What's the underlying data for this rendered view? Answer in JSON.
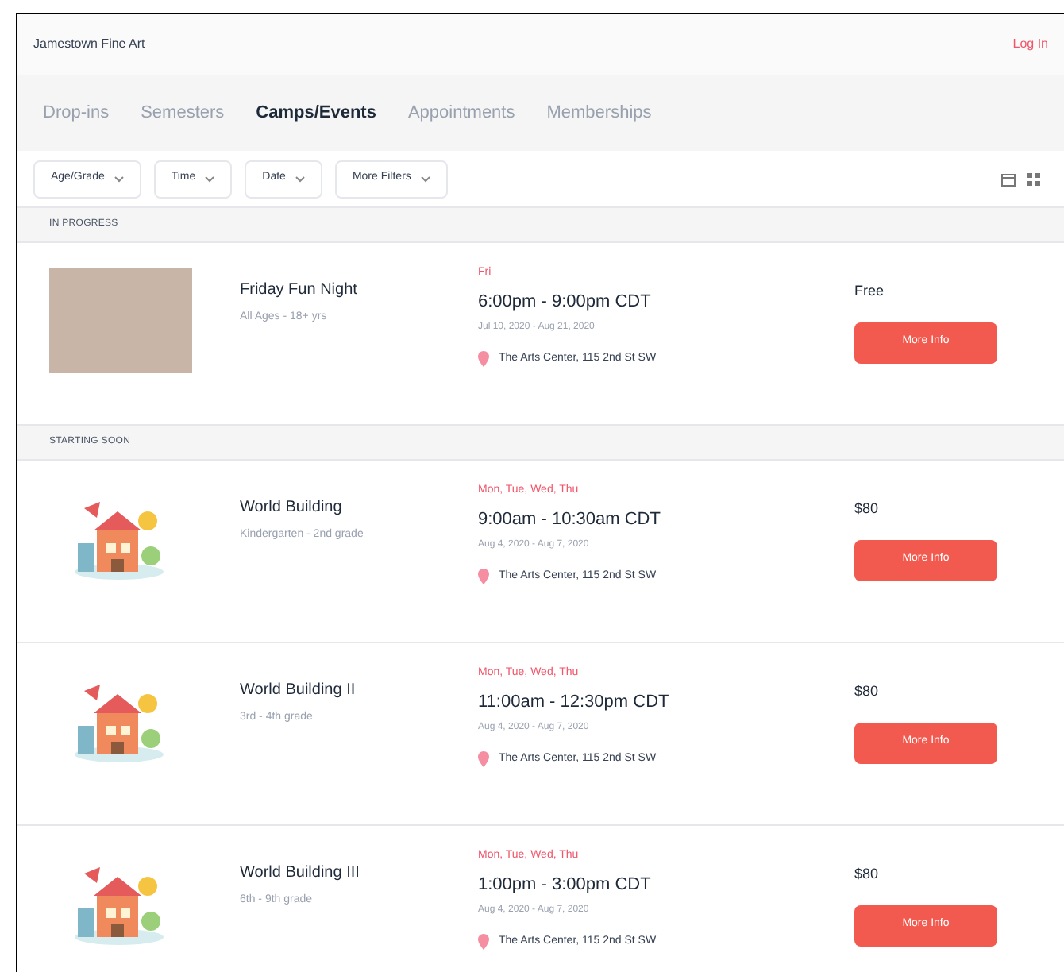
{
  "header": {
    "title": "Jamestown Fine Art",
    "login": "Log In"
  },
  "tabs": [
    {
      "label": "Drop-ins",
      "selected": false
    },
    {
      "label": "Semesters",
      "selected": false
    },
    {
      "label": "Camps/Events",
      "selected": true
    },
    {
      "label": "Appointments",
      "selected": false
    },
    {
      "label": "Memberships",
      "selected": false
    }
  ],
  "filters": [
    "Age/Grade",
    "Time",
    "Date",
    "More Filters"
  ],
  "sections": [
    {
      "heading": "IN PROGRESS",
      "events": [
        {
          "kind": "photo",
          "title": "Friday Fun Night",
          "ages": "All Ages - 18+ yrs",
          "days": "Fri",
          "time": "6:00pm - 9:00pm CDT",
          "dates": "Jul 10, 2020 - Aug 21, 2020",
          "location": "The Arts Center, 115 2nd St SW",
          "price": "Free",
          "button": "More Info"
        }
      ]
    },
    {
      "heading": "STARTING SOON",
      "events": [
        {
          "kind": "illustration",
          "title": "World Building",
          "ages": "Kindergarten - 2nd grade",
          "days": "Mon, Tue, Wed, Thu",
          "time": "9:00am - 10:30am CDT",
          "dates": "Aug 4, 2020 - Aug 7, 2020",
          "location": "The Arts Center, 115 2nd St SW",
          "price": "$80",
          "button": "More Info"
        },
        {
          "kind": "illustration",
          "title": "World Building II",
          "ages": "3rd - 4th grade",
          "days": "Mon, Tue, Wed, Thu",
          "time": "11:00am - 12:30pm CDT",
          "dates": "Aug 4, 2020 - Aug 7, 2020",
          "location": "The Arts Center, 115 2nd St SW",
          "price": "$80",
          "button": "More Info"
        },
        {
          "kind": "illustration",
          "title": "World Building III",
          "ages": "6th - 9th grade",
          "days": "Mon, Tue, Wed, Thu",
          "time": "1:00pm - 3:00pm CDT",
          "dates": "Aug 4, 2020 - Aug 7, 2020",
          "location": "The Arts Center, 115 2nd St SW",
          "price": "$80",
          "button": "More Info"
        }
      ]
    }
  ]
}
